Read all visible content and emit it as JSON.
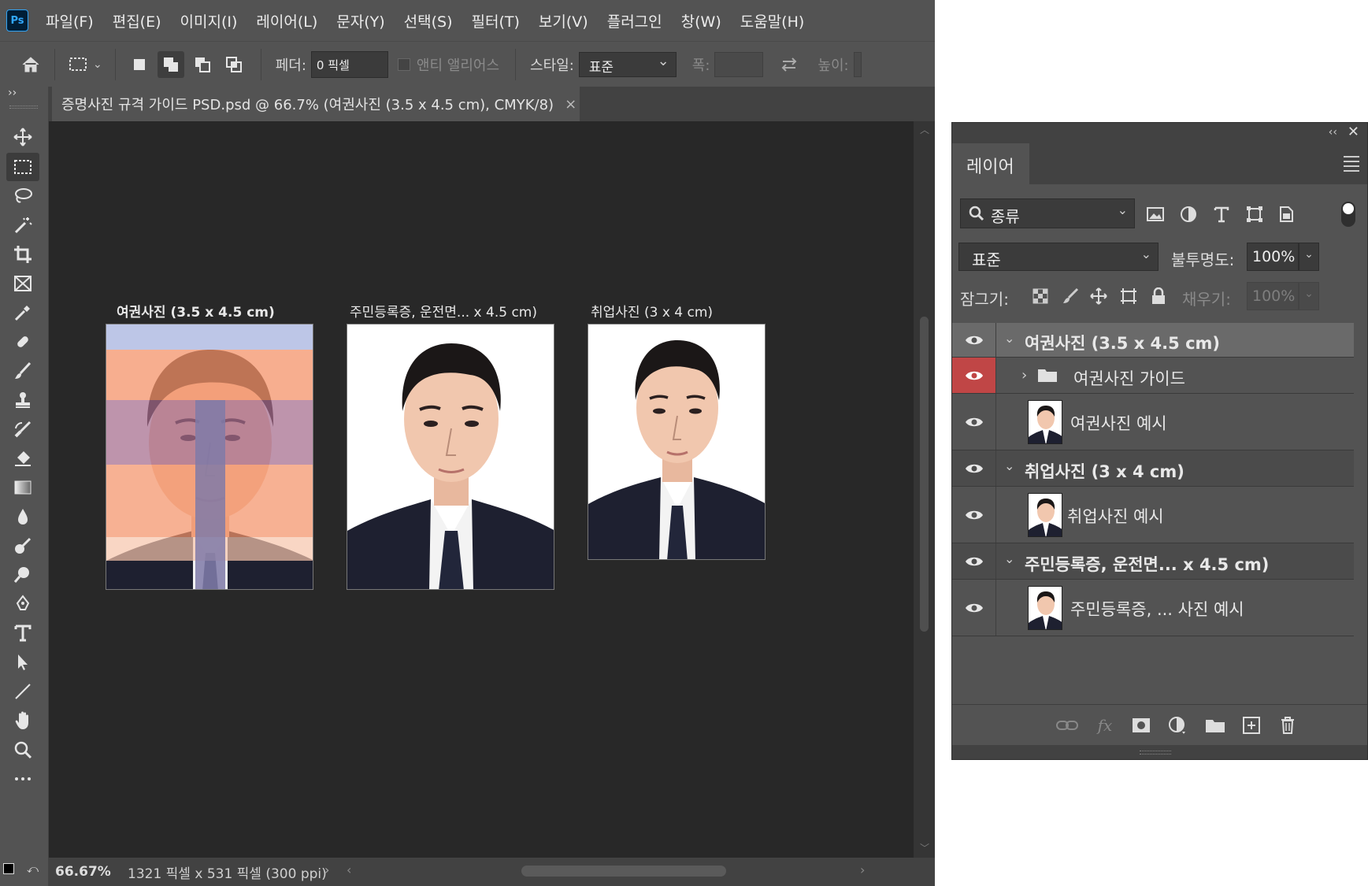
{
  "app": {
    "logo": "Ps",
    "menu": [
      "파일(F)",
      "편집(E)",
      "이미지(I)",
      "레이어(L)",
      "문자(Y)",
      "선택(S)",
      "필터(T)",
      "보기(V)",
      "플러그인",
      "창(W)",
      "도움말(H)"
    ]
  },
  "options_bar": {
    "feather_label": "페더:",
    "feather_value": "0 픽셀",
    "antialias_label": "앤티 앨리어스",
    "style_label": "스타일:",
    "style_value": "표준",
    "width_label": "폭:",
    "height_label": "높이:"
  },
  "document": {
    "tab_title": "증명사진 규격 가이드 PSD.psd @ 66.7% (여권사진 (3.5 x 4.5 cm), CMYK/8)",
    "close_glyph": "×",
    "zoom": "66.67%",
    "info": "1321 픽셀 x 531 픽셀 (300 ppi)"
  },
  "artboards": [
    {
      "label": "여권사진 (3.5 x 4.5 cm)",
      "guide_overlay": true
    },
    {
      "label": "주민등록증, 운전면... x 4.5 cm)",
      "guide_overlay": false
    },
    {
      "label": "취업사진 (3 x 4 cm)",
      "guide_overlay": false
    }
  ],
  "layers_panel": {
    "tab": "레이어",
    "filter_value": "종류",
    "blend_mode": "표준",
    "opacity_label": "불투명도:",
    "opacity_value": "100%",
    "lock_label": "잠그기:",
    "fill_label": "채우기:",
    "fill_value": "100%",
    "collapse_glyph": "‹‹",
    "close_glyph": "✕",
    "layers": [
      {
        "name": "여권사진 (3.5 x 4.5 cm)",
        "type": "group",
        "expanded": true,
        "selected": true
      },
      {
        "name": "여권사진 가이드",
        "type": "folder",
        "expanded": false,
        "visibility_highlight": "red"
      },
      {
        "name": "여권사진 예시",
        "type": "image"
      },
      {
        "name": "취업사진 (3 x 4 cm)",
        "type": "group",
        "expanded": true
      },
      {
        "name": "취업사진 예시",
        "type": "image"
      },
      {
        "name": "주민등록증, 운전면... x 4.5 cm)",
        "type": "group",
        "expanded": true
      },
      {
        "name": "주민등록증, ... 사진 예시",
        "type": "image"
      }
    ]
  },
  "colors": {
    "ui_bg": "#535353",
    "canvas_bg": "#282828",
    "guide_orange": "#f4936a",
    "guide_blue": "#b9c3e6",
    "guide_purple": "#7f7aa8",
    "red_highlight": "#c04646",
    "suit": "#1e2030"
  }
}
